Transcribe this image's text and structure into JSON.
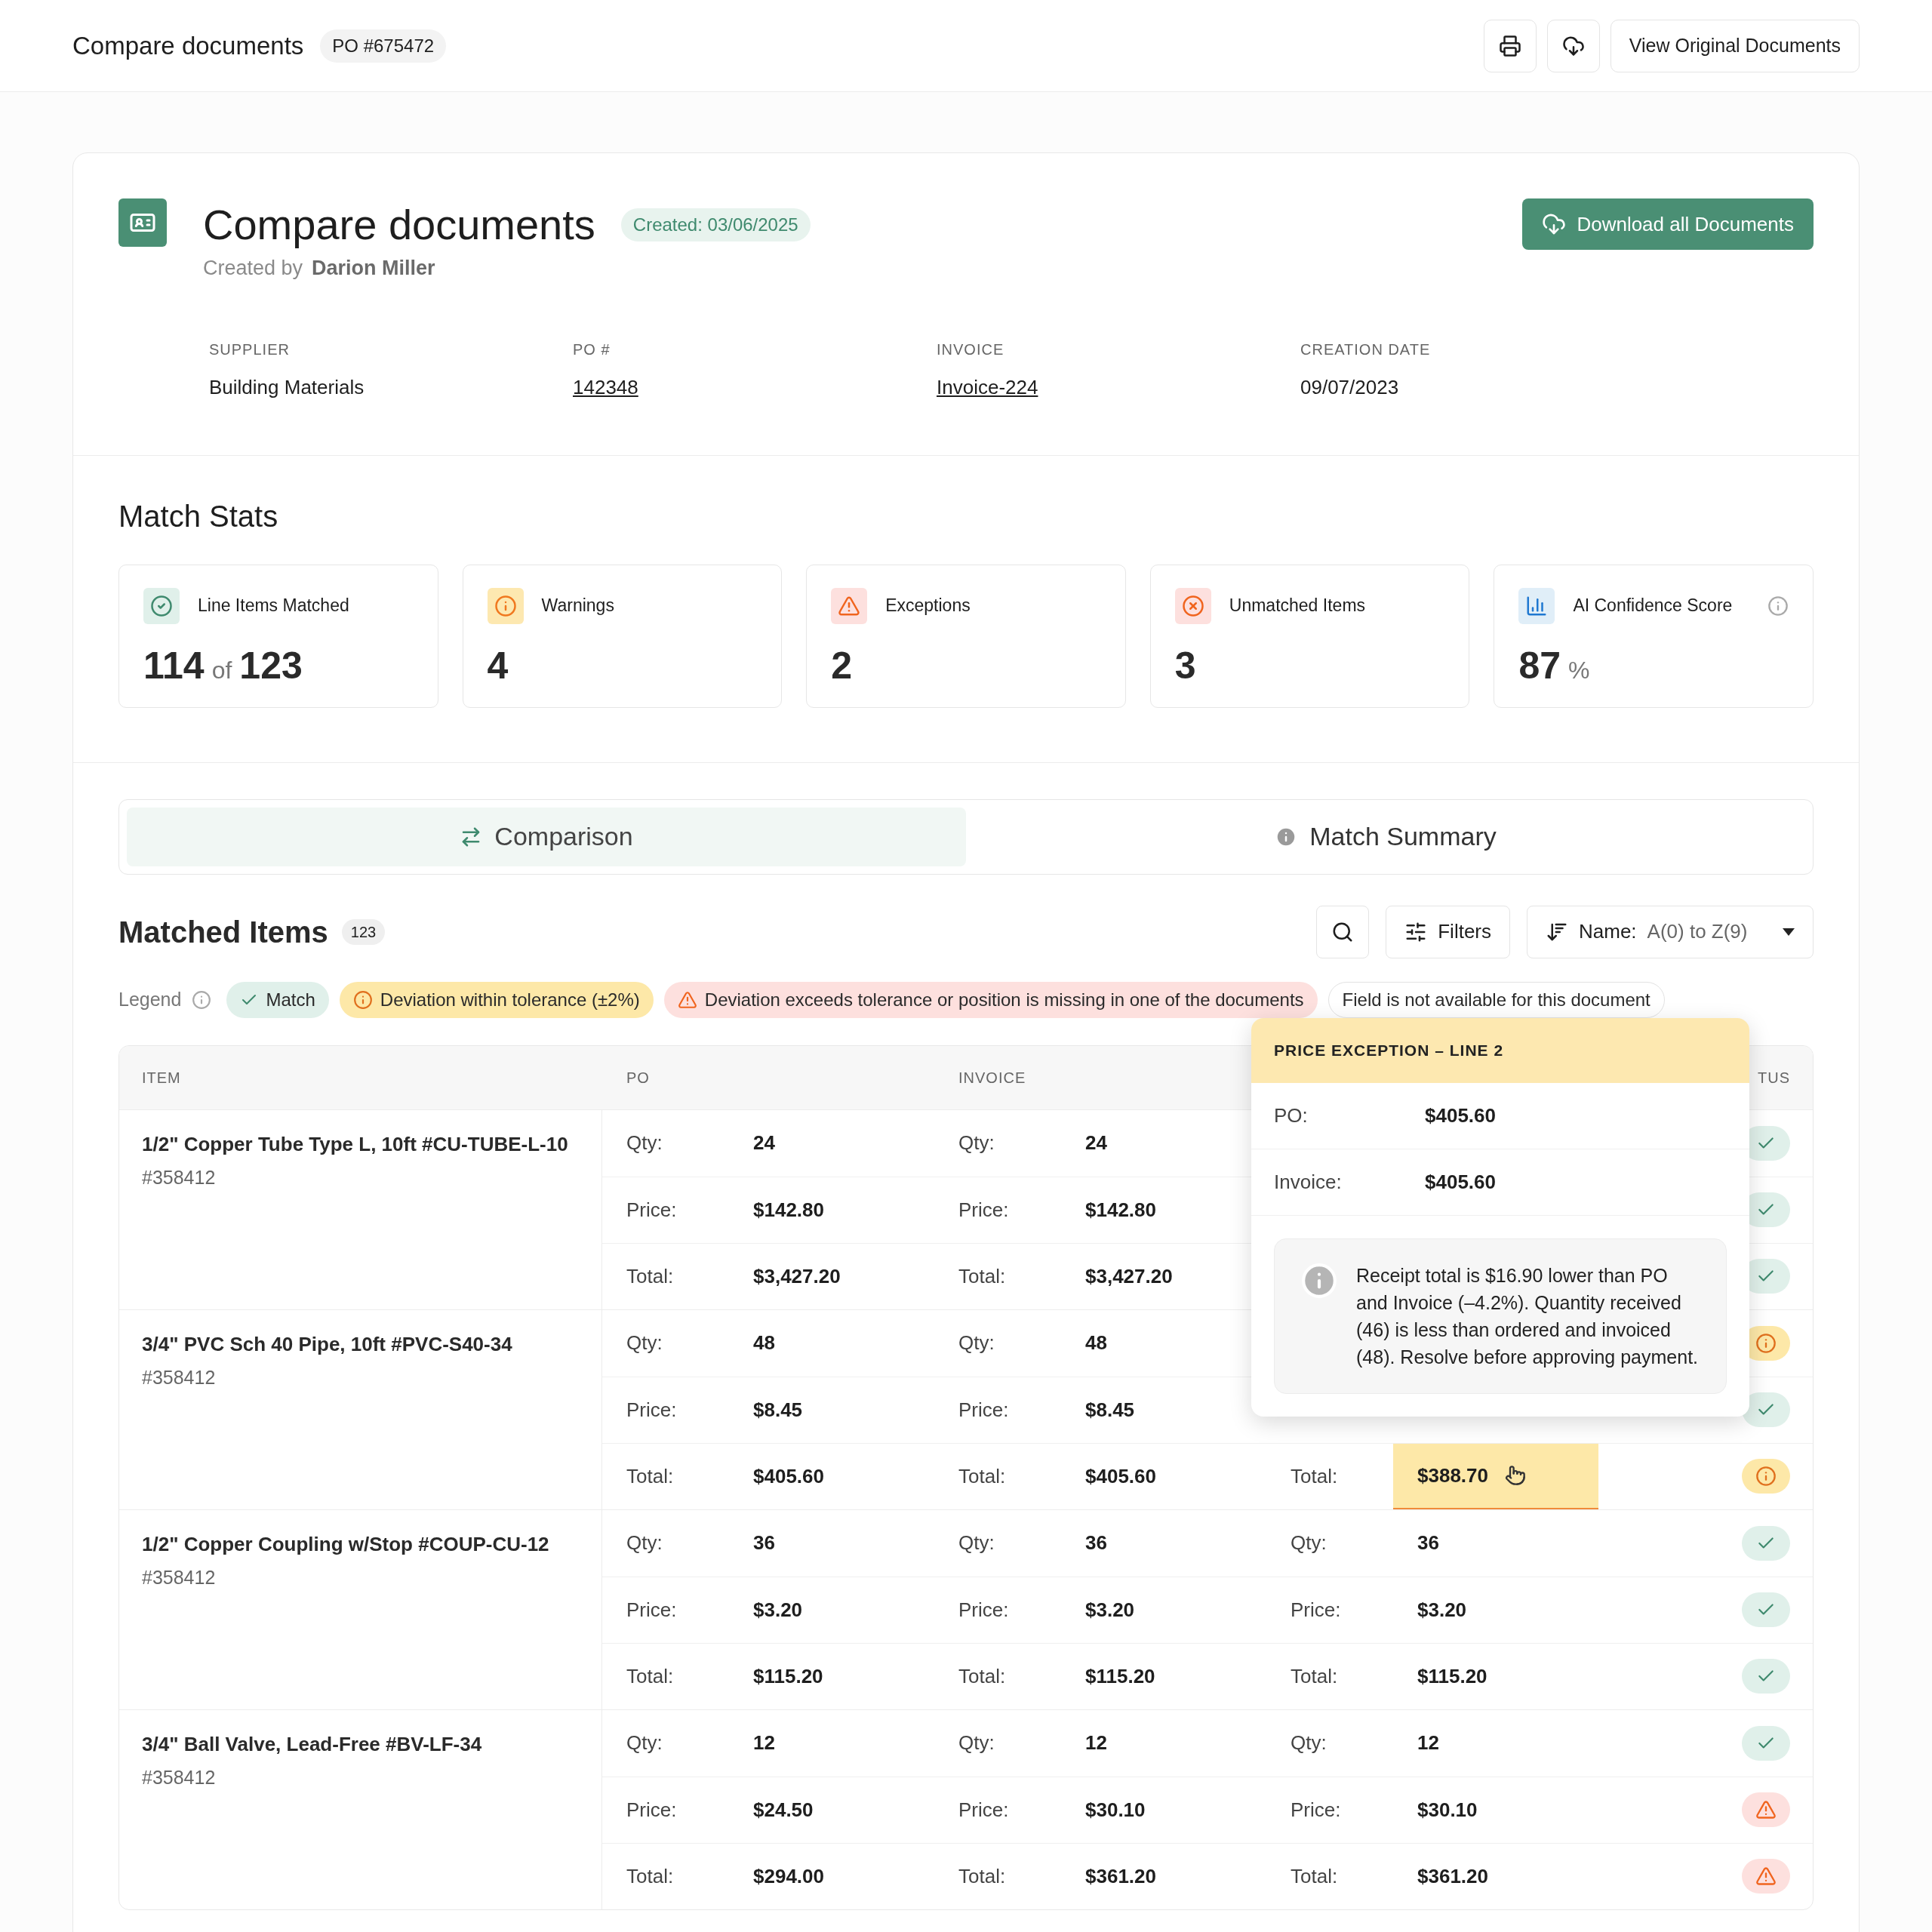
{
  "topbar": {
    "title": "Compare documents",
    "po_badge": "PO #675472",
    "view_button": "View Original Documents"
  },
  "header": {
    "title": "Compare documents",
    "created_badge": "Created: 03/06/2025",
    "created_by_label": "Created by",
    "created_by": "Darion Miller",
    "download_button": "Download all Documents"
  },
  "details": [
    {
      "label": "SUPPLIER",
      "value": "Building Materials",
      "link": false
    },
    {
      "label": "PO #",
      "value": "142348",
      "link": true
    },
    {
      "label": "INVOICE",
      "value": "Invoice-224",
      "link": true
    },
    {
      "label": "CREATION DATE",
      "value": "09/07/2023",
      "link": false
    }
  ],
  "match_stats": {
    "title": "Match Stats",
    "cards": [
      {
        "kind": "matched",
        "label": "Line Items Matched",
        "value": "114",
        "of": "of",
        "total": "123"
      },
      {
        "kind": "warning",
        "label": "Warnings",
        "value": "4"
      },
      {
        "kind": "exception",
        "label": "Exceptions",
        "value": "2"
      },
      {
        "kind": "unmatched",
        "label": "Unmatched Items",
        "value": "3"
      },
      {
        "kind": "confidence",
        "label": "AI Confidence Score",
        "value": "87",
        "unit": "%"
      }
    ]
  },
  "tabs": [
    {
      "kind": "comparison",
      "label": "Comparison",
      "selected": true
    },
    {
      "kind": "summary",
      "label": "Match Summary",
      "selected": false
    }
  ],
  "matched_items": {
    "title": "Matched Items",
    "count": "123",
    "filters_button": "Filters",
    "sort_label": "Name:",
    "sort_value": "A(0) to Z(9)"
  },
  "legend": {
    "label": "Legend",
    "items": [
      {
        "kind": "match",
        "label": "Match"
      },
      {
        "kind": "warning",
        "label": "Deviation within tolerance (±2%)"
      },
      {
        "kind": "exception",
        "label": "Deviation exceeds tolerance or position is missing in one of the documents"
      },
      {
        "kind": "missing",
        "label": "Field is not available for this document"
      }
    ]
  },
  "table": {
    "columns": [
      "ITEM",
      "PO",
      "INVOICE",
      "TUS"
    ],
    "rows": [
      {
        "name": "1/2\" Copper Tube Type L, 10ft #CU-TUBE-L-10",
        "sku": "#358412",
        "lines": [
          {
            "po_label": "Qty:",
            "po": "24",
            "invoice_label": "Qty:",
            "invoice": "24",
            "status": {
              "kind": "match"
            }
          },
          {
            "po_label": "Price:",
            "po": "$142.80",
            "invoice_label": "Price:",
            "invoice": "$142.80",
            "status": {
              "kind": "match"
            }
          },
          {
            "po_label": "Total:",
            "po": "$3,427.20",
            "invoice_label": "Total:",
            "invoice": "$3,427.20",
            "status": {
              "kind": "match"
            }
          }
        ]
      },
      {
        "name": "3/4\" PVC Sch 40 Pipe, 10ft #PVC-S40-34",
        "sku": "#358412",
        "lines": [
          {
            "po_label": "Qty:",
            "po": "48",
            "invoice_label": "Qty:",
            "invoice": "48",
            "status": {
              "kind": "warning"
            }
          },
          {
            "po_label": "Price:",
            "po": "$8.45",
            "invoice_label": "Price:",
            "invoice": "$8.45",
            "status": {
              "kind": "match"
            }
          },
          {
            "po_label": "Total:",
            "po": "$405.60",
            "invoice_label": "Total:",
            "invoice": "$405.60",
            "receipt_label": "Total:",
            "receipt": "$388.70",
            "highlighted": true,
            "status": {
              "kind": "warning"
            }
          }
        ]
      },
      {
        "name": "1/2\" Copper Coupling w/Stop #COUP-CU-12",
        "sku": "#358412",
        "lines": [
          {
            "po_label": "Qty:",
            "po": "36",
            "invoice_label": "Qty:",
            "invoice": "36",
            "receipt_label": "Qty:",
            "receipt": "36",
            "highlighted": false,
            "status": {
              "kind": "match"
            }
          },
          {
            "po_label": "Price:",
            "po": "$3.20",
            "invoice_label": "Price:",
            "invoice": "$3.20",
            "receipt_label": "Price:",
            "receipt": "$3.20",
            "highlighted": false,
            "status": {
              "kind": "match"
            }
          },
          {
            "po_label": "Total:",
            "po": "$115.20",
            "invoice_label": "Total:",
            "invoice": "$115.20",
            "receipt_label": "Total:",
            "receipt": "$115.20",
            "highlighted": false,
            "status": {
              "kind": "match"
            }
          }
        ]
      },
      {
        "name": "3/4\" Ball Valve, Lead-Free #BV-LF-34",
        "sku": "#358412",
        "lines": [
          {
            "po_label": "Qty:",
            "po": "12",
            "invoice_label": "Qty:",
            "invoice": "12",
            "receipt_label": "Qty:",
            "receipt": "12",
            "highlighted": false,
            "status": {
              "kind": "match"
            }
          },
          {
            "po_label": "Price:",
            "po": "$24.50",
            "invoice_label": "Price:",
            "invoice": "$30.10",
            "receipt_label": "Price:",
            "receipt": "$30.10",
            "highlighted": false,
            "status": {
              "kind": "exception"
            }
          },
          {
            "po_label": "Total:",
            "po": "$294.00",
            "invoice_label": "Total:",
            "invoice": "$361.20",
            "receipt_label": "Total:",
            "receipt": "$361.20",
            "highlighted": false,
            "status": {
              "kind": "exception"
            }
          }
        ]
      }
    ]
  },
  "tooltip": {
    "title": "PRICE EXCEPTION – LINE 2",
    "fields": [
      {
        "label": "PO:",
        "value": "$405.60"
      },
      {
        "label": "Invoice:",
        "value": "$405.60"
      }
    ],
    "note": "Receipt total is $16.90 lower than PO and Invoice (–4.2%). Quantity received (46) is less than ordered and invoiced (48). Resolve before approving payment."
  }
}
